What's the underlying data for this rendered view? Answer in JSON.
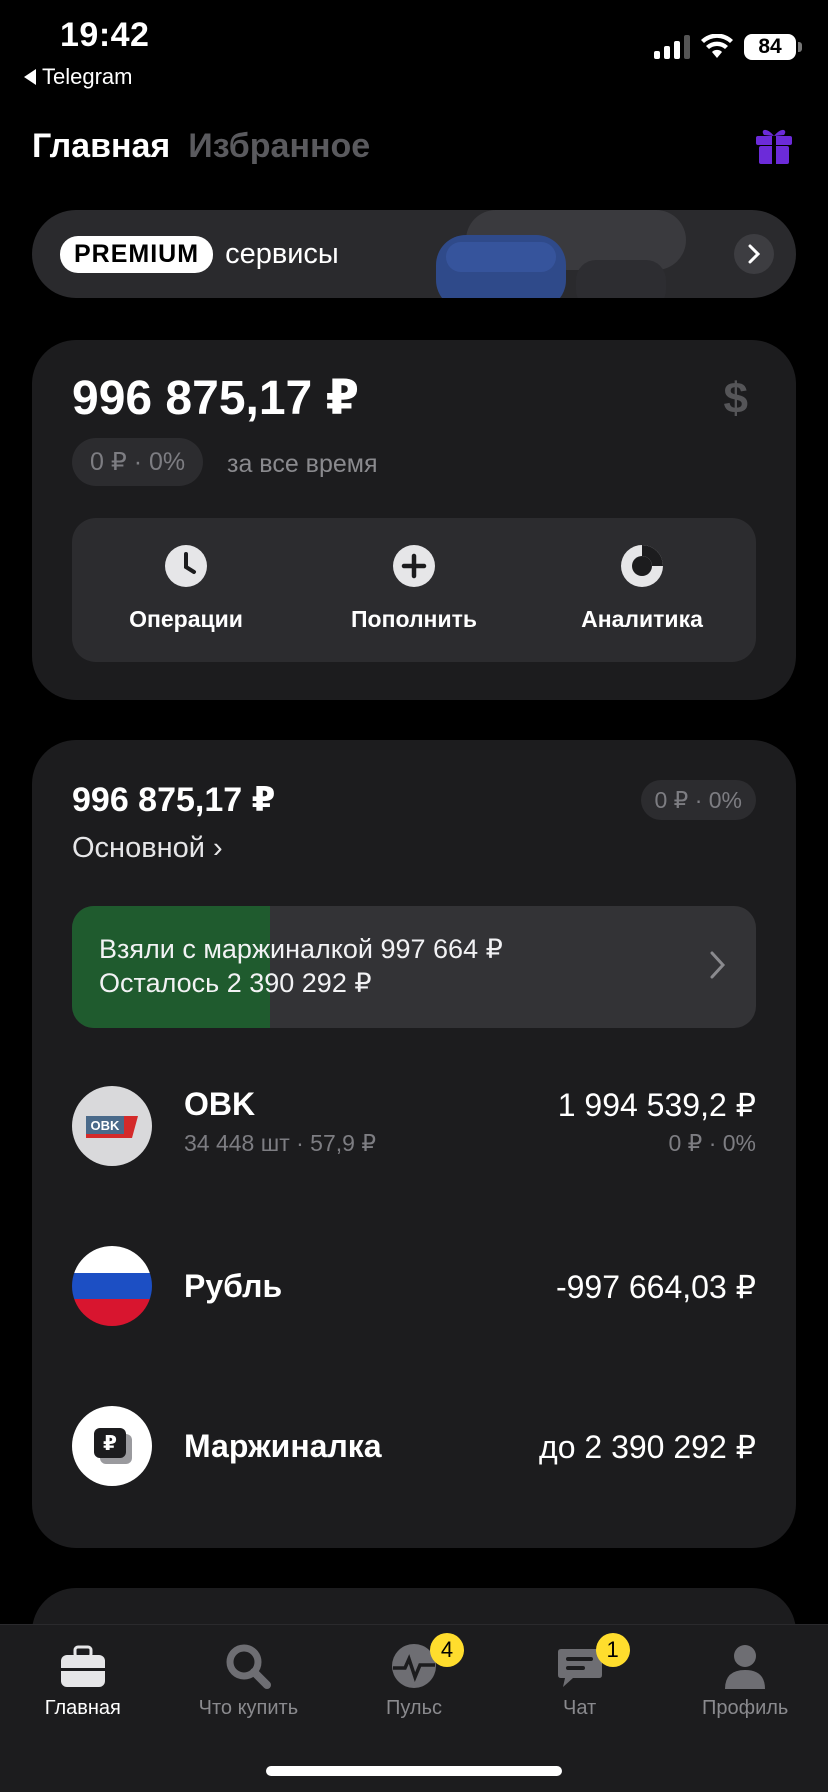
{
  "status_bar": {
    "time": "19:42",
    "back_label": "Telegram",
    "battery": "84"
  },
  "header": {
    "tab_main": "Главная",
    "tab_favorites": "Избранное",
    "gift_icon": "gift-icon",
    "gift_color": "#6c2bd9"
  },
  "premium": {
    "badge": "PREMIUM",
    "text": "сервисы"
  },
  "balance": {
    "amount": "996 875,17 ₽",
    "currency_symbol": "$",
    "change": "0 ₽ · 0%",
    "change_label": "за все время",
    "actions": [
      {
        "label": "Операции",
        "icon": "clock-icon"
      },
      {
        "label": "Пополнить",
        "icon": "plus-icon"
      },
      {
        "label": "Аналитика",
        "icon": "pie-chart-icon"
      }
    ]
  },
  "portfolio": {
    "amount": "996 875,17 ₽",
    "change": "0 ₽ · 0%",
    "name": "Основной ›",
    "margin_banner": {
      "line1": "Взяли с маржиналкой 997 664 ₽",
      "line2": "Осталось 2 390 292 ₽",
      "used_fraction": 0.29,
      "fill_color": "#1f5b2e"
    },
    "assets": [
      {
        "name": "OBK",
        "sub": "34 448 шт · 57,9 ₽",
        "value": "1 994 539,2 ₽",
        "sub_right": "0 ₽ · 0%",
        "logo": "obk-logo",
        "logo_text": "OBK"
      },
      {
        "name": "Рубль",
        "sub": "",
        "value": "-997 664,03 ₽",
        "sub_right": "",
        "logo": "russian-flag-icon"
      },
      {
        "name": "Маржиналка",
        "sub": "",
        "value": "до 2 390 292 ₽",
        "sub_right": "",
        "logo": "ruble-wallet-icon"
      }
    ]
  },
  "bottom_nav": [
    {
      "label": "Главная",
      "icon": "briefcase-icon",
      "active": true,
      "badge": ""
    },
    {
      "label": "Что купить",
      "icon": "search-icon",
      "active": false,
      "badge": ""
    },
    {
      "label": "Пульс",
      "icon": "pulse-icon",
      "active": false,
      "badge": "4"
    },
    {
      "label": "Чат",
      "icon": "chat-icon",
      "active": false,
      "badge": "1"
    },
    {
      "label": "Профиль",
      "icon": "profile-icon",
      "active": false,
      "badge": ""
    }
  ]
}
